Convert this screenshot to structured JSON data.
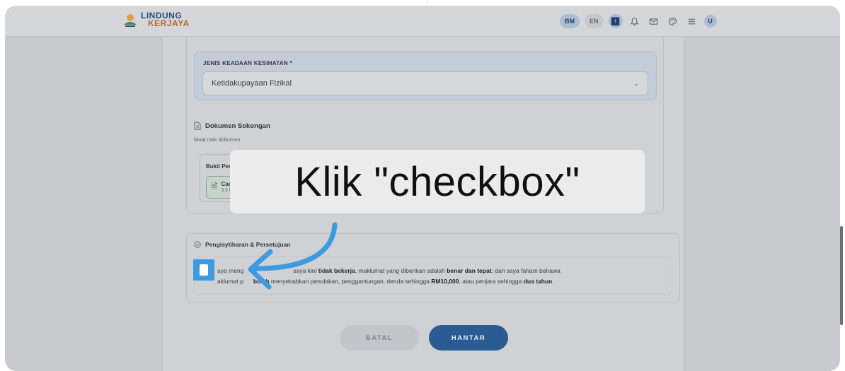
{
  "header": {
    "logo_line1": "LINDUNG",
    "logo_line2": "KERJAYA",
    "lang_bm": "BM",
    "lang_en": "EN",
    "accessibility_icon": "accessibility-icon",
    "bell_icon": "bell-icon",
    "mail_icon": "mail-icon",
    "palette_icon": "palette-icon",
    "menu_icon": "menu-icon",
    "avatar": "U"
  },
  "form": {
    "condition_label": "JENIS KEADAAN KESIHATAN *",
    "condition_value": "Ketidakupayaan Fizikal",
    "docs_title": "Dokumen Sokongan",
    "docs_sub": "Muat naik dokumen",
    "upload_label": "Bukti Per",
    "file_name": "Cas",
    "file_size": "3.5 M",
    "declaration_title": "Pengisytiharan & Persetujuan",
    "declaration_line1_a": "aya meng",
    "declaration_line1_b": "saya kini ",
    "declaration_line1_bold1": "tidak bekerja",
    "declaration_line1_c": ", maklumat yang diberikan adalah ",
    "declaration_line1_bold2": "benar dan tepat",
    "declaration_line1_d": ", dan saya faham bahawa",
    "declaration_line2_a": "aklumat p",
    "declaration_line2_bold1": "boleh",
    "declaration_line2_b": " menyebabkan penolakan, penggantungan, denda sehingga ",
    "declaration_line2_bold2": "RM10,000",
    "declaration_line2_c": ", atau penjara sehingga ",
    "declaration_line2_bold3": "dua tahun",
    "declaration_line2_d": ".",
    "cancel_label": "BATAL",
    "submit_label": "HANTAR"
  },
  "overlay": {
    "instruction": "Klik \"checkbox\"",
    "accent_color": "#3d9ae0"
  }
}
